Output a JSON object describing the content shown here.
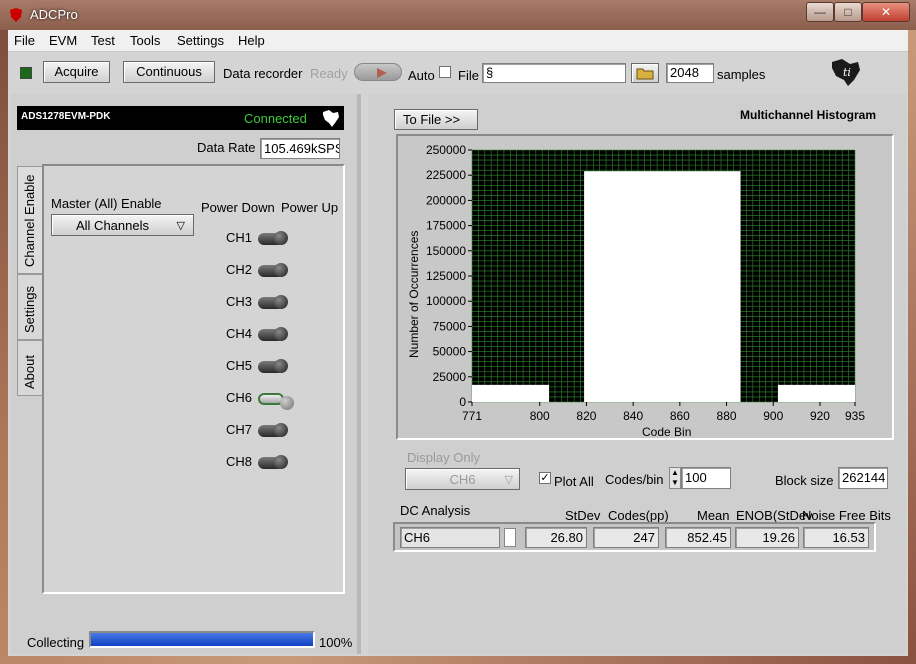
{
  "window": {
    "title": "ADCPro",
    "minimize": "—",
    "maximize": "□",
    "close": "✕"
  },
  "menu": [
    "File",
    "EVM",
    "Test",
    "Tools",
    "Settings",
    "Help"
  ],
  "toolbar": {
    "acquire": "Acquire",
    "continuous": "Continuous",
    "data_recorder": "Data recorder",
    "ready": "Ready",
    "auto": "Auto",
    "file": "File",
    "file_path_prefix": "§",
    "samples_value": "2048",
    "samples_label": "samples"
  },
  "device": {
    "name": "ADS1278EVM-PDK",
    "status": "Connected",
    "data_rate_label": "Data Rate",
    "data_rate_value": "105.469kSPS"
  },
  "tabs": [
    "Channel Enable",
    "Settings",
    "About"
  ],
  "channel_enable": {
    "master_label": "Master (All) Enable",
    "master_value": "All Channels",
    "power_down": "Power Down",
    "power_up": "Power Up",
    "channels": [
      {
        "label": "CH1",
        "power_up": false
      },
      {
        "label": "CH2",
        "power_up": false
      },
      {
        "label": "CH3",
        "power_up": false
      },
      {
        "label": "CH4",
        "power_up": false
      },
      {
        "label": "CH5",
        "power_up": false
      },
      {
        "label": "CH6",
        "power_up": true
      },
      {
        "label": "CH7",
        "power_up": false
      },
      {
        "label": "CH8",
        "power_up": false
      }
    ]
  },
  "status_bar": {
    "label": "Collecting",
    "progress": 1.0,
    "percent": "100%"
  },
  "right": {
    "to_file": "To File  >>",
    "plot_title": "Multichannel Histogram",
    "display_only": "Display Only",
    "display_channel": "CH6",
    "plot_all_label": "Plot All",
    "codes_bin_label": "Codes/bin",
    "codes_bin_value": "100",
    "block_size_label": "Block size",
    "block_size_value": "262144"
  },
  "dc_analysis": {
    "title": "DC Analysis",
    "headers": [
      "StDev",
      "Codes(pp)",
      "Mean",
      "ENOB(StDev)",
      "Noise Free Bits"
    ],
    "channel": "CH6",
    "values": [
      "26.80",
      "247",
      "852.45",
      "19.26",
      "16.53"
    ]
  },
  "chart_data": {
    "type": "bar",
    "title": "",
    "xlabel": "Code Bin",
    "ylabel": "Number of Occurrences",
    "xlim": [
      771,
      935
    ],
    "ylim": [
      0,
      250000
    ],
    "x_ticks": [
      "771",
      "800",
      "820",
      "840",
      "860",
      "880",
      "900",
      "920",
      "935"
    ],
    "x_tick_values": [
      771,
      800,
      820,
      840,
      860,
      880,
      900,
      920,
      935
    ],
    "y_ticks": [
      "250000",
      "225000",
      "200000",
      "175000",
      "150000",
      "125000",
      "100000",
      "75000",
      "50000",
      "25000",
      "0"
    ],
    "y_tick_values": [
      250000,
      225000,
      200000,
      175000,
      150000,
      125000,
      100000,
      75000,
      50000,
      25000,
      0
    ],
    "bars": [
      {
        "x0": 771,
        "x1": 804,
        "value": 17000
      },
      {
        "x0": 819,
        "x1": 886,
        "value": 229000
      },
      {
        "x0": 902,
        "x1": 935,
        "value": 17000
      }
    ],
    "grid": true,
    "background_color": "#000000",
    "grid_color": "#2e8b2e",
    "bar_color": "#ffffff"
  }
}
